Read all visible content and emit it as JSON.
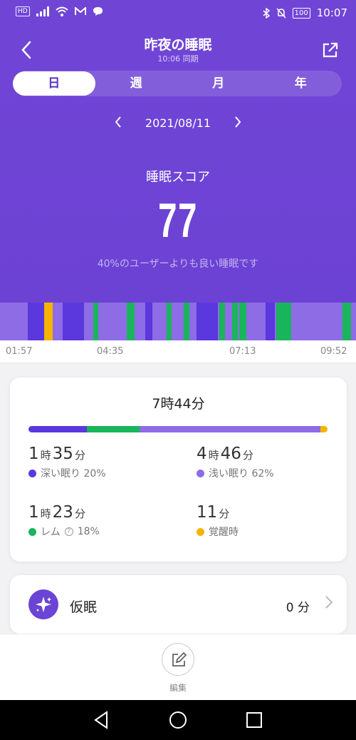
{
  "status_bar": {
    "hd": "HD",
    "time": "10:07",
    "battery": "100"
  },
  "header": {
    "title": "昨夜の睡眠",
    "subtitle": "10:06 同期",
    "tabs": [
      {
        "label": "日",
        "active": true
      },
      {
        "label": "週",
        "active": false
      },
      {
        "label": "月",
        "active": false
      },
      {
        "label": "年",
        "active": false
      }
    ],
    "date": "2021/08/11",
    "score_label": "睡眠スコア",
    "score": "77",
    "score_description": "40%のユーザーよりも良い睡眠です"
  },
  "chart_data": {
    "type": "sleep-stage-timeline",
    "stages": [
      {
        "name": "浅い眠り",
        "color": "#8d6ce5"
      },
      {
        "name": "深い眠り",
        "color": "#5a38de"
      },
      {
        "name": "レム",
        "color": "#19b55a"
      },
      {
        "name": "覚醒時",
        "color": "#f5b400"
      }
    ],
    "x_ticks": [
      "01:57",
      "04:35",
      "07:13",
      "09:52"
    ],
    "segments": [
      {
        "start": 0.078,
        "end": 0.124,
        "stage": "深い眠り"
      },
      {
        "start": 0.124,
        "end": 0.148,
        "stage": "覚醒時"
      },
      {
        "start": 0.176,
        "end": 0.236,
        "stage": "深い眠り"
      },
      {
        "start": 0.262,
        "end": 0.276,
        "stage": "レム"
      },
      {
        "start": 0.356,
        "end": 0.378,
        "stage": "レム"
      },
      {
        "start": 0.408,
        "end": 0.428,
        "stage": "深い眠り"
      },
      {
        "start": 0.468,
        "end": 0.482,
        "stage": "レム"
      },
      {
        "start": 0.516,
        "end": 0.532,
        "stage": "レム"
      },
      {
        "start": 0.552,
        "end": 0.612,
        "stage": "深い眠り"
      },
      {
        "start": 0.616,
        "end": 0.632,
        "stage": "レム"
      },
      {
        "start": 0.652,
        "end": 0.668,
        "stage": "レム"
      },
      {
        "start": 0.672,
        "end": 0.692,
        "stage": "レム"
      },
      {
        "start": 0.746,
        "end": 0.772,
        "stage": "深い眠り"
      },
      {
        "start": 0.776,
        "end": 0.818,
        "stage": "レム"
      },
      {
        "start": 0.962,
        "end": 0.986,
        "stage": "レム"
      }
    ]
  },
  "summary": {
    "total_label": "7時44分",
    "bar": [
      {
        "stage": "深い眠り",
        "percent": 20,
        "color": "#5a38de"
      },
      {
        "stage": "レム",
        "percent": 18,
        "color": "#19b55a"
      },
      {
        "stage": "浅い眠り",
        "percent": 62,
        "color": "#8d6ce5"
      },
      {
        "stage": "覚醒時",
        "percent": 2.4,
        "color": "#f5b400"
      }
    ],
    "deep": {
      "hours": "1",
      "h_unit": "時",
      "minutes": "35",
      "m_unit": "分",
      "label": "深い眠り 20%",
      "color": "#5a38de"
    },
    "light": {
      "hours": "4",
      "h_unit": "時",
      "minutes": "46",
      "m_unit": "分",
      "label": "浅い眠り 62%",
      "color": "#8d6ce5"
    },
    "rem": {
      "hours": "1",
      "h_unit": "時",
      "minutes": "23",
      "m_unit": "分",
      "label": "レム",
      "help": "?",
      "percent": "18%",
      "color": "#19b55a"
    },
    "awake": {
      "minutes": "11",
      "m_unit": "分",
      "label": "覚醒時",
      "color": "#f5b400"
    }
  },
  "nap": {
    "label": "仮眠",
    "value": "0 分"
  },
  "bottom": {
    "edit_label": "編集"
  }
}
